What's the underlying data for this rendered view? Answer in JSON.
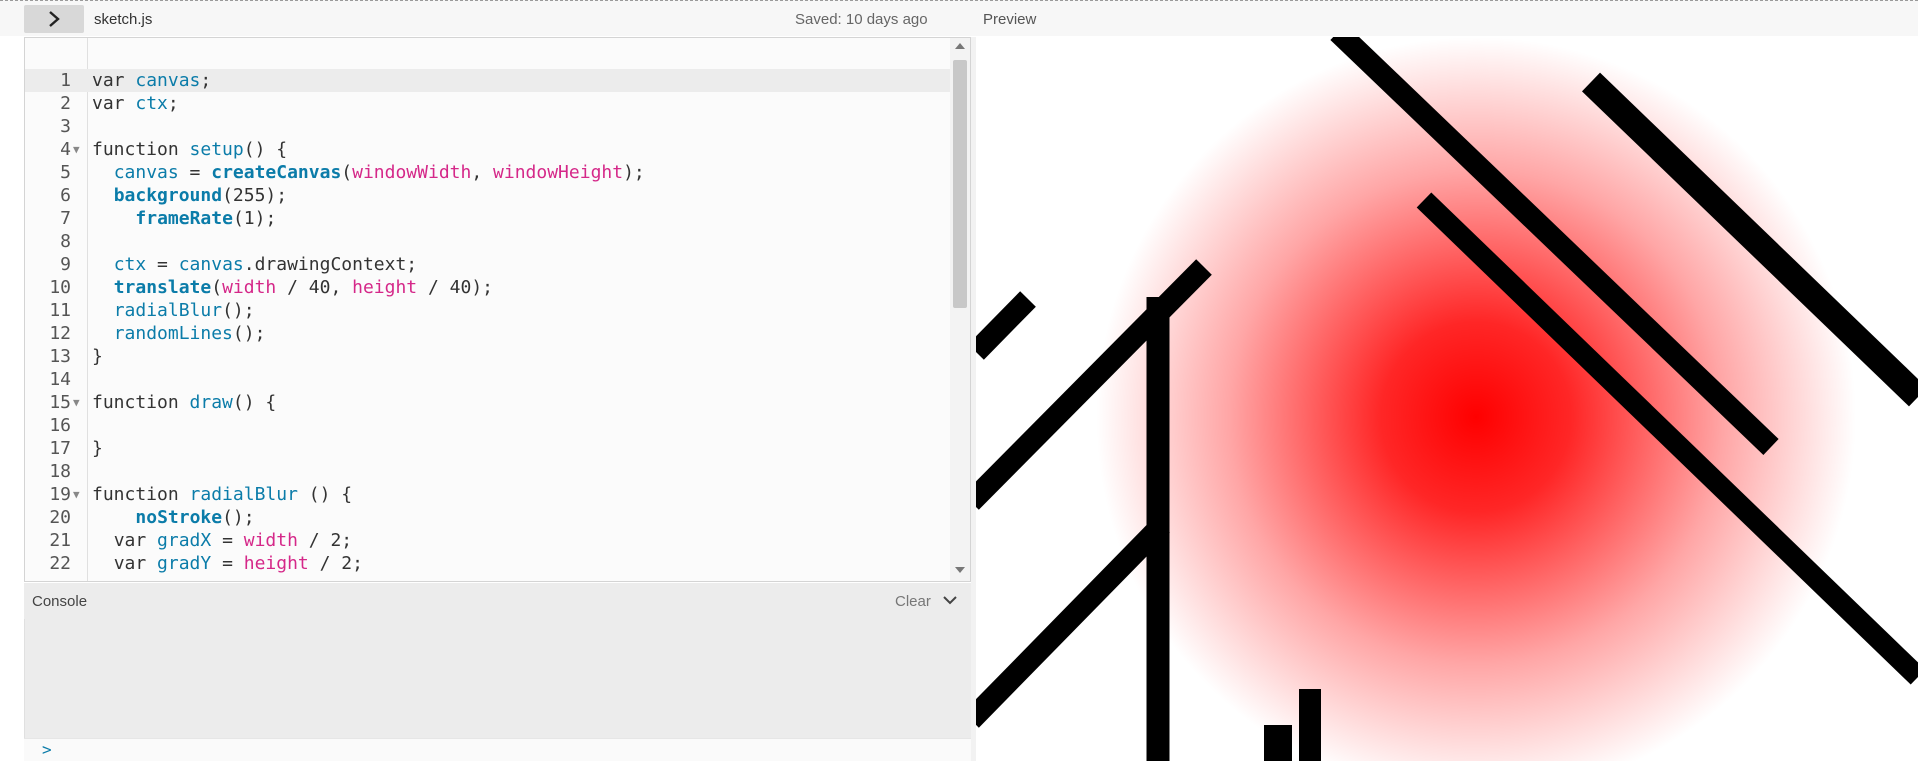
{
  "toolbar": {
    "toggle_icon": "chevron-right-icon",
    "filename": "sketch.js",
    "saved_status": "Saved: 10 days ago",
    "preview_label": "Preview"
  },
  "editor": {
    "active_line": 1,
    "lines": [
      {
        "n": "1",
        "fold": false,
        "indent": 0,
        "tokens": [
          [
            "kw",
            "var "
          ],
          [
            "def",
            "canvas"
          ],
          [
            "kw",
            ";"
          ]
        ]
      },
      {
        "n": "2",
        "fold": false,
        "indent": 0,
        "tokens": [
          [
            "kw",
            "var "
          ],
          [
            "def",
            "ctx"
          ],
          [
            "kw",
            ";"
          ]
        ]
      },
      {
        "n": "3",
        "fold": false,
        "indent": 0,
        "tokens": []
      },
      {
        "n": "4",
        "fold": true,
        "indent": 0,
        "tokens": [
          [
            "kw",
            "function "
          ],
          [
            "def",
            "setup"
          ],
          [
            "kw",
            "() {"
          ]
        ]
      },
      {
        "n": "5",
        "fold": false,
        "indent": 2,
        "tokens": [
          [
            "def",
            "canvas"
          ],
          [
            "kw",
            " = "
          ],
          [
            "fn",
            "createCanvas"
          ],
          [
            "kw",
            "("
          ],
          [
            "pk",
            "windowWidth"
          ],
          [
            "kw",
            ", "
          ],
          [
            "pk",
            "windowHeight"
          ],
          [
            "kw",
            ");"
          ]
        ]
      },
      {
        "n": "6",
        "fold": false,
        "indent": 2,
        "tokens": [
          [
            "fn",
            "background"
          ],
          [
            "kw",
            "(255);"
          ]
        ]
      },
      {
        "n": "7",
        "fold": false,
        "indent": 4,
        "tokens": [
          [
            "fn",
            "frameRate"
          ],
          [
            "kw",
            "(1);"
          ]
        ]
      },
      {
        "n": "8",
        "fold": false,
        "indent": 0,
        "tokens": []
      },
      {
        "n": "9",
        "fold": false,
        "indent": 2,
        "tokens": [
          [
            "def",
            "ctx"
          ],
          [
            "kw",
            " = "
          ],
          [
            "def",
            "canvas"
          ],
          [
            "kw",
            ".drawingContext;"
          ]
        ]
      },
      {
        "n": "10",
        "fold": false,
        "indent": 2,
        "tokens": [
          [
            "fn",
            "translate"
          ],
          [
            "kw",
            "("
          ],
          [
            "pk",
            "width"
          ],
          [
            "kw",
            " / 40, "
          ],
          [
            "pk",
            "height"
          ],
          [
            "kw",
            " / 40);"
          ]
        ]
      },
      {
        "n": "11",
        "fold": false,
        "indent": 2,
        "tokens": [
          [
            "def",
            "radialBlur"
          ],
          [
            "kw",
            "();"
          ]
        ]
      },
      {
        "n": "12",
        "fold": false,
        "indent": 2,
        "tokens": [
          [
            "def",
            "randomLines"
          ],
          [
            "kw",
            "();"
          ]
        ]
      },
      {
        "n": "13",
        "fold": false,
        "indent": 0,
        "tokens": [
          [
            "kw",
            "}"
          ]
        ]
      },
      {
        "n": "14",
        "fold": false,
        "indent": 0,
        "tokens": []
      },
      {
        "n": "15",
        "fold": true,
        "indent": 0,
        "tokens": [
          [
            "kw",
            "function "
          ],
          [
            "def",
            "draw"
          ],
          [
            "kw",
            "() {"
          ]
        ]
      },
      {
        "n": "16",
        "fold": false,
        "indent": 0,
        "tokens": []
      },
      {
        "n": "17",
        "fold": false,
        "indent": 0,
        "tokens": [
          [
            "kw",
            "}"
          ]
        ]
      },
      {
        "n": "18",
        "fold": false,
        "indent": 0,
        "tokens": []
      },
      {
        "n": "19",
        "fold": true,
        "indent": 0,
        "tokens": [
          [
            "kw",
            "function "
          ],
          [
            "def",
            "radialBlur"
          ],
          [
            "kw",
            " () {"
          ]
        ]
      },
      {
        "n": "20",
        "fold": false,
        "indent": 4,
        "tokens": [
          [
            "fn",
            "noStroke"
          ],
          [
            "kw",
            "();"
          ]
        ]
      },
      {
        "n": "21",
        "fold": false,
        "indent": 2,
        "tokens": [
          [
            "kw",
            "var "
          ],
          [
            "def",
            "gradX"
          ],
          [
            "kw",
            " = "
          ],
          [
            "pk",
            "width"
          ],
          [
            "kw",
            " / 2;"
          ]
        ]
      },
      {
        "n": "22",
        "fold": false,
        "indent": 2,
        "tokens": [
          [
            "kw",
            "var "
          ],
          [
            "def",
            "gradY"
          ],
          [
            "kw",
            " = "
          ],
          [
            "pk",
            "height"
          ],
          [
            "kw",
            " / 2;"
          ]
        ]
      }
    ]
  },
  "console": {
    "title": "Console",
    "clear_label": "Clear",
    "collapse_icon": "chevron-down-icon",
    "prompt": ">"
  },
  "preview": {
    "gradient_color": "#ff0000",
    "background": "#ffffff",
    "line_color": "#000000"
  }
}
